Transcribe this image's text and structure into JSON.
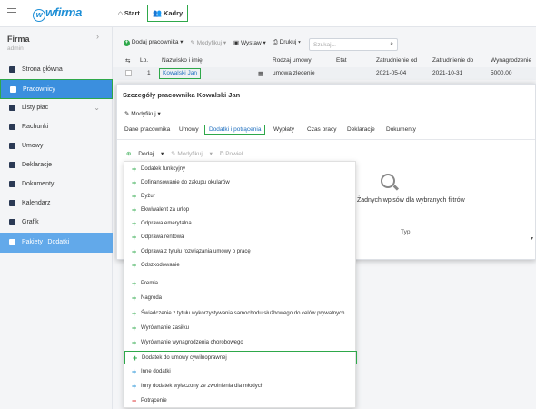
{
  "app": {
    "logo": "wfirma"
  },
  "topnav": {
    "start": "Start",
    "kadry": "Kadry"
  },
  "sidebar": {
    "firma": "Firma",
    "firma_sub": "admin",
    "items": [
      {
        "label": "Strona główna"
      },
      {
        "label": "Pracownicy"
      },
      {
        "label": "Listy płac"
      },
      {
        "label": "Rachunki"
      },
      {
        "label": "Umowy"
      },
      {
        "label": "Deklaracje"
      },
      {
        "label": "Dokumenty"
      },
      {
        "label": "Kalendarz"
      },
      {
        "label": "Grafik"
      },
      {
        "label": "Pakiety i Dodatki"
      }
    ]
  },
  "toolbar": {
    "add": "Dodaj pracownika",
    "modify": "Modyfikuj",
    "issue": "Wystaw",
    "print": "Drukuj",
    "search_placeholder": "Szukaj..."
  },
  "table": {
    "headers": [
      "Lp.",
      "Nazwisko i imię",
      "Rodzaj umowy",
      "Etat",
      "Zatrudnienie od",
      "Zatrudnienie do",
      "Wynagrodzenie"
    ],
    "rows": [
      {
        "lp": "1",
        "name": "Kowalski Jan",
        "contract": "umowa zlecenie",
        "etat": "",
        "from": "2021-05-04",
        "to": "2021-10-31",
        "salary": "5000.00"
      }
    ]
  },
  "modal": {
    "title": "Szczegóły pracownika Kowalski Jan",
    "modify": "Modyfikuj",
    "tabs": [
      "Dane pracownika",
      "Umowy",
      "Dodatki i potrącenia",
      "Wypłaty",
      "Czas pracy",
      "Deklaracje",
      "Dokumenty"
    ],
    "subbar": {
      "add": "Dodaj",
      "modify": "Modyfikuj",
      "repeat": "Powiel"
    },
    "empty": "Żadnych wpisów dla wybranych filtrów",
    "typ_label": "Typ"
  },
  "dropdown": {
    "items": [
      {
        "label": "Dodatek funkcyjny",
        "kind": "green"
      },
      {
        "label": "Dofinansowanie do zakupu okularów",
        "kind": "green"
      },
      {
        "label": "Dyżur",
        "kind": "green"
      },
      {
        "label": "Ekwiwalent za urlop",
        "kind": "green"
      },
      {
        "label": "Odprawa emerytalna",
        "kind": "green"
      },
      {
        "label": "Odprawa rentowa",
        "kind": "green"
      },
      {
        "label": "Odprawa z tytułu rozwiązania umowy o pracę",
        "kind": "green"
      },
      {
        "label": "Odszkodowanie",
        "kind": "green"
      },
      {
        "label": "Premia",
        "kind": "green"
      },
      {
        "label": "Nagroda",
        "kind": "green"
      },
      {
        "label": "Świadczenie z tytułu wykorzystywania samochodu służbowego do celów prywatnych",
        "kind": "green"
      },
      {
        "label": "Wyrównanie zasiłku",
        "kind": "green"
      },
      {
        "label": "Wyrównanie wynagrodzenia chorobowego",
        "kind": "green"
      },
      {
        "label": "Dodatek do umowy cywilnoprawnej",
        "kind": "green"
      },
      {
        "label": "Inne dodatki",
        "kind": "blue"
      },
      {
        "label": "Inny dodatek wyłączony ze zwolnienia dla młodych",
        "kind": "blue"
      },
      {
        "label": "Potrącenie",
        "kind": "red"
      }
    ]
  },
  "colors": {
    "accent": "#3b8fde",
    "highlight": "#2ea84a",
    "link": "#1e6fbf"
  }
}
